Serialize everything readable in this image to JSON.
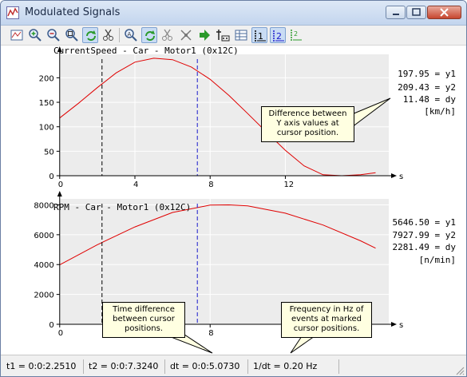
{
  "window": {
    "title": "Modulated Signals"
  },
  "toolbar": {
    "icons": [
      "graph-settings-icon",
      "zoom-in-icon",
      "zoom-out-icon",
      "zoom-fit-icon",
      "refresh-icon",
      "cut-icon",
      "zoom-x-icon",
      "refresh-alt-icon",
      "cut-alt-icon",
      "clear-cuts-icon",
      "go-next-icon",
      "cursor-icon",
      "table-icon",
      "cursor-1-icon",
      "cursor-2-icon",
      "cursor-sync-icon"
    ]
  },
  "chart_data": [
    {
      "type": "line",
      "title": "CurrentSpeed - Car - Motor1 (0x12C)",
      "xlabel": "s",
      "xlim": [
        -0.5,
        17.5
      ],
      "ylim": [
        0,
        248
      ],
      "x_ticks": [
        0,
        4,
        8,
        12
      ],
      "y_ticks": [
        0,
        50,
        100,
        150,
        200
      ],
      "x_tick_labels": [
        "0",
        "4",
        "8",
        "12"
      ],
      "y_tick_labels": [
        "0",
        "50",
        "100",
        "150",
        "200"
      ],
      "grid": true,
      "series": [
        {
          "color": "#e00000",
          "x": [
            0,
            1,
            2,
            3,
            4,
            5,
            6,
            7,
            8,
            9,
            10,
            11,
            12,
            13,
            14,
            15,
            16,
            16.8
          ],
          "y": [
            118,
            148,
            180,
            210,
            232,
            240,
            237,
            222,
            197,
            164,
            127,
            89,
            52,
            20,
            2,
            0,
            2,
            6
          ]
        }
      ],
      "cursors": [
        2.25,
        7.32
      ],
      "readout": {
        "y1": "197.95 = y1",
        "y2": "209.43 = y2",
        "dy": "11.48 = dy",
        "unit": "[km/h]"
      }
    },
    {
      "type": "line",
      "title": "RPM - Car - Motor1 (0x12C)",
      "xlabel": "s",
      "xlim": [
        -0.5,
        17.5
      ],
      "ylim": [
        0,
        8400
      ],
      "x_ticks": [
        0,
        8
      ],
      "y_ticks": [
        0,
        2000,
        4000,
        6000,
        8000
      ],
      "x_tick_labels": [
        "0",
        "8"
      ],
      "y_tick_labels": [
        "0",
        "2000",
        "4000",
        "6000",
        "8000"
      ],
      "grid": true,
      "series": [
        {
          "color": "#e00000",
          "x": [
            0,
            2,
            4,
            6,
            8,
            9,
            10,
            12,
            14,
            16,
            16.8
          ],
          "y": [
            3980,
            5330,
            6520,
            7490,
            7980,
            8000,
            7930,
            7440,
            6650,
            5590,
            5100
          ]
        }
      ],
      "cursors": [
        2.25,
        7.32
      ],
      "readout": {
        "y1": "5646.50 = y1",
        "y2": "7927.99 = y2",
        "dy": "2281.49 = dy",
        "unit": "[n/min]"
      }
    }
  ],
  "tooltips": {
    "dy_help": "Difference between Y axis values at cursor position.",
    "dt_help": "Time difference between cursor positions.",
    "freq_help": "Frequency in Hz of events at marked cursor positions."
  },
  "status": {
    "t1": "t1 = 0:0:2.2510",
    "t2": "t2 = 0:0:7.3240",
    "dt": "dt = 0:0:5.0730",
    "freq": "1/dt = 0.20 Hz"
  },
  "colors": {
    "signal": "#e00000",
    "cursor1": "#000000",
    "cursor2": "#1a1acc",
    "plot_bg": "#ececec"
  }
}
